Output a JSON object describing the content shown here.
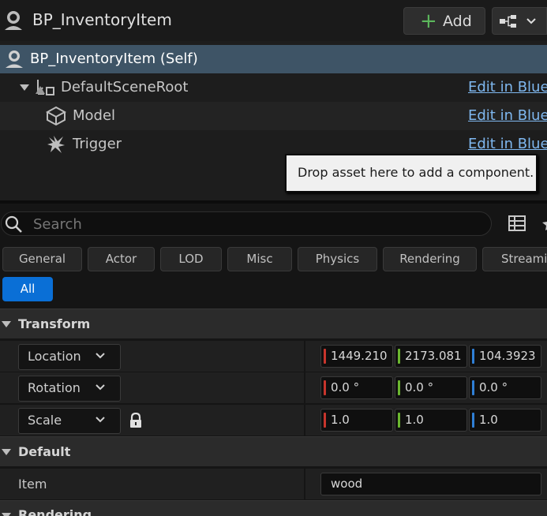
{
  "header": {
    "title": "BP_InventoryItem",
    "add_label": "Add"
  },
  "tree": {
    "rows": [
      {
        "label": "BP_InventoryItem (Self)"
      },
      {
        "label": "DefaultSceneRoot",
        "edit": "Edit in Blue"
      },
      {
        "label": "Model",
        "edit": "Edit in Blue"
      },
      {
        "label": "Trigger",
        "edit": "Edit in Blue"
      }
    ],
    "tooltip": "Drop asset here to add a component."
  },
  "search": {
    "placeholder": "Search"
  },
  "filters": {
    "chips": [
      "General",
      "Actor",
      "LOD",
      "Misc",
      "Physics",
      "Rendering",
      "Streaming"
    ],
    "all": "All"
  },
  "transform": {
    "title": "Transform",
    "location": {
      "label": "Location",
      "x": "1449.210",
      "y": "2173.081",
      "z": "104.3923"
    },
    "rotation": {
      "label": "Rotation",
      "x": "0.0 °",
      "y": "0.0 °",
      "z": "0.0 °"
    },
    "scale": {
      "label": "Scale",
      "x": "1.0",
      "y": "1.0",
      "z": "1.0"
    }
  },
  "default_section": {
    "title": "Default",
    "item_label": "Item",
    "item_value": "wood"
  },
  "rendering_section": {
    "title": "Rendering"
  },
  "colors": {
    "selection": "#3e5466",
    "accent": "#0a6fd6",
    "axis_x": "#c8352c",
    "axis_y": "#6bb72f",
    "axis_z": "#2f7fd6",
    "add_plus": "#5cb85c",
    "link": "#7fb8f0"
  }
}
